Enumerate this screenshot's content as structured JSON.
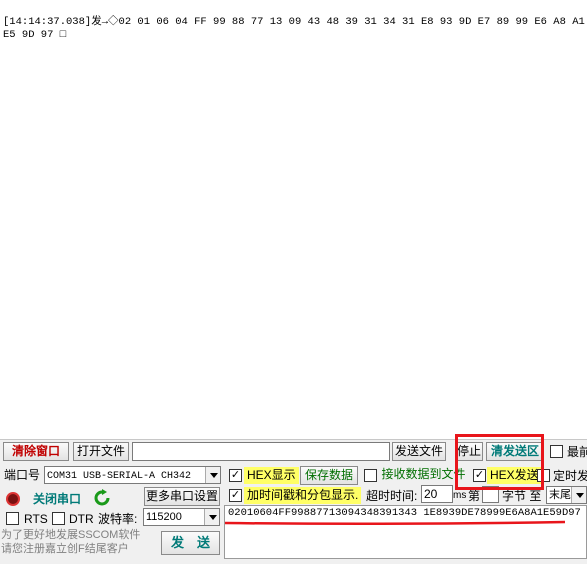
{
  "receive": {
    "text": "[14:14:37.038]发→◇02 01 06 04 FF 99 88 77 13 09 43 48 39 31 34 31 E8 93 9D E7 89 99 E6 A8 A1 E5 9D 97 □"
  },
  "toolbar": {
    "clear_window": "清除窗口",
    "open_file": "打开文件",
    "send_file": "发送文件",
    "stop": "停止",
    "clear_send": "清发送区",
    "top_most": "最前"
  },
  "port": {
    "label": "端口号",
    "value": "COM31 USB-SERIAL-A CH342",
    "close_port": "关闭串口",
    "more_settings": "更多串口设置",
    "rts": "RTS",
    "dtr": "DTR",
    "baud_label": "波特率:",
    "baud_value": "115200",
    "promo": "为了更好地发展SSCOM软件\n请您注册嘉立创F结尾客户",
    "send": "发　送"
  },
  "options": {
    "hex_display": "HEX显示",
    "save_data": "保存数据",
    "recv_to_file": "接收数据到文件",
    "hex_send": "HEX发送",
    "timed_send": "定时发",
    "timestamp": "加时间戳和分包显示.",
    "timeout_label": "超时时间:",
    "timeout_value": "20",
    "timeout_unit": "ms",
    "byte_no": "第",
    "byte_label": "字节 至",
    "end_value": "末尾"
  },
  "send_data": "02010604FF99887713094348391343 1E8939DE78999E6A8A1E59D97",
  "colors": {
    "annotation": "#e8151b",
    "highlight": "#ffff66"
  }
}
